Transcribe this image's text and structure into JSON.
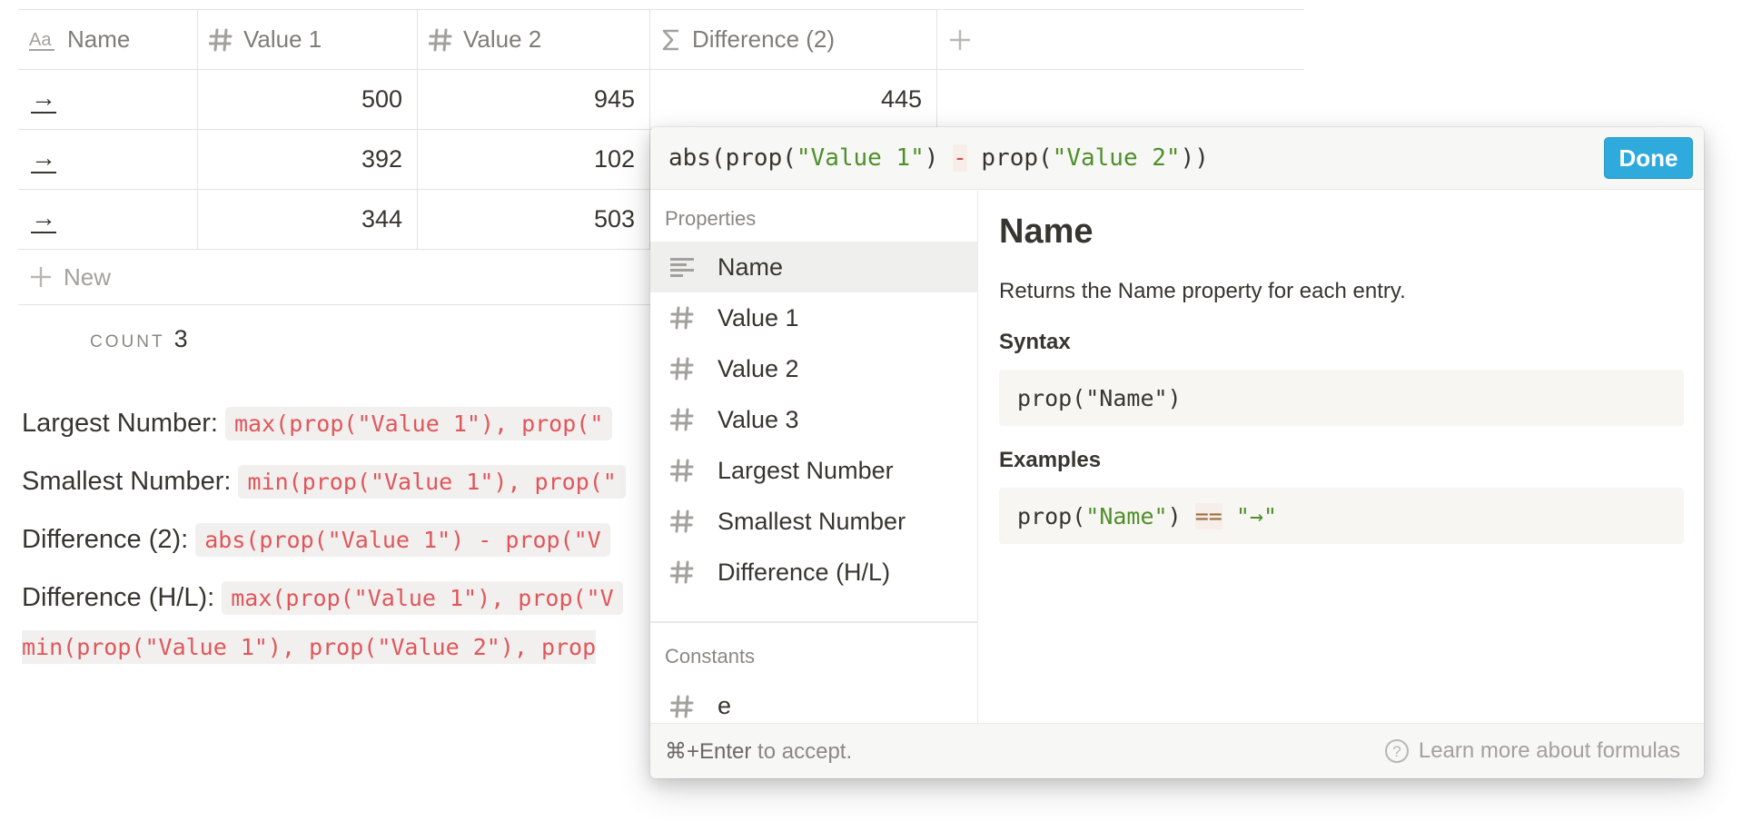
{
  "table": {
    "columns": [
      {
        "icon": "text-icon",
        "label": "Name"
      },
      {
        "icon": "hash-icon",
        "label": "Value 1"
      },
      {
        "icon": "hash-icon",
        "label": "Value 2"
      },
      {
        "icon": "sigma-icon",
        "label": "Difference (2)"
      }
    ],
    "rows": [
      {
        "name": "→",
        "v1": "500",
        "v2": "945",
        "diff": "445"
      },
      {
        "name": "→",
        "v1": "392",
        "v2": "102",
        "diff": ""
      },
      {
        "name": "→",
        "v1": "344",
        "v2": "503",
        "diff": ""
      }
    ],
    "new_label": "New",
    "count_label": "COUNT",
    "count_value": "3"
  },
  "notes": [
    {
      "label": "Largest Number:",
      "code": "max(prop(\"Value 1\"), prop(\""
    },
    {
      "label": "Smallest Number:",
      "code": "min(prop(\"Value 1\"), prop(\""
    },
    {
      "label": "Difference (2):",
      "code": "abs(prop(\"Value 1\") - prop(\"V"
    },
    {
      "label": "Difference (H/L):",
      "code": "max(prop(\"Value 1\"), prop(\"V"
    }
  ],
  "notes_wrap_line": "min(prop(\"Value 1\"), prop(\"Value 2\"), prop",
  "popup": {
    "formula": {
      "p1": "abs(prop(",
      "s1": "\"Value 1\"",
      "p2": ") ",
      "op": "-",
      "p3": " prop(",
      "s2": "\"Value 2\"",
      "p4": "))"
    },
    "done_label": "Done",
    "properties_title": "Properties",
    "properties": [
      {
        "icon": "text-lines-icon",
        "label": "Name",
        "selected": true
      },
      {
        "icon": "hash-icon",
        "label": "Value 1"
      },
      {
        "icon": "hash-icon",
        "label": "Value 2"
      },
      {
        "icon": "hash-icon",
        "label": "Value 3"
      },
      {
        "icon": "hash-icon",
        "label": "Largest Number"
      },
      {
        "icon": "hash-icon",
        "label": "Smallest Number"
      },
      {
        "icon": "hash-icon",
        "label": "Difference (H/L)"
      }
    ],
    "constants_title": "Constants",
    "constants": [
      {
        "icon": "hash-icon",
        "label": "e"
      }
    ],
    "doc": {
      "title": "Name",
      "description": "Returns the Name property for each entry.",
      "syntax_title": "Syntax",
      "syntax": "prop(\"Name\")",
      "examples_title": "Examples",
      "example": {
        "p1": "prop(",
        "s1": "\"Name\"",
        "p2": ") ",
        "op": "==",
        "p3": " ",
        "s2": "\"→\""
      }
    },
    "footer": {
      "shortcut": "⌘+Enter",
      "shortcut_suffix": " to accept.",
      "learn_more": "Learn more about formulas"
    }
  },
  "colors": {
    "done_button": "#2eaadc",
    "code_red": "#e0565b",
    "string_green": "#4f8f2a"
  }
}
